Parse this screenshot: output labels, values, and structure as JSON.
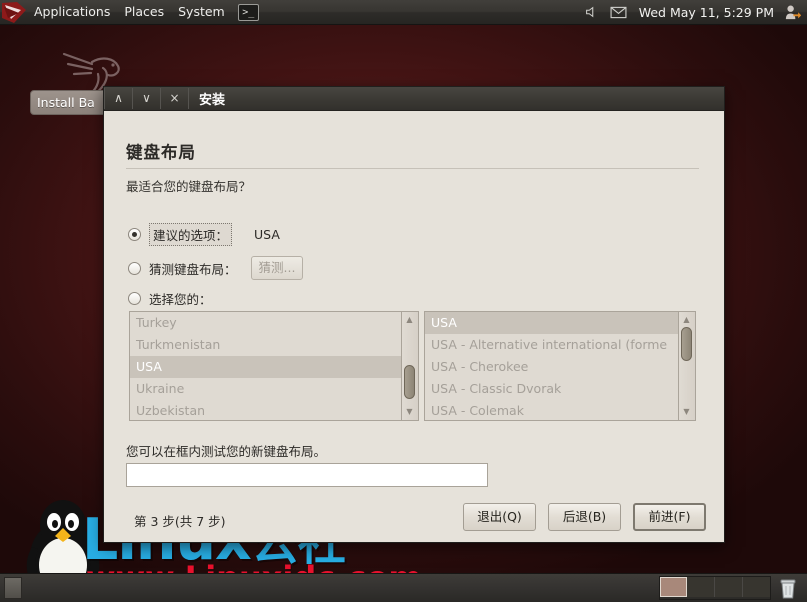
{
  "panel_top": {
    "logo_icon": "kali-dragon-logo",
    "menus": [
      "Applications",
      "Places",
      "System"
    ],
    "terminal_launcher_label": ">_",
    "tray": {
      "volume_icon": "speaker-icon",
      "mail_icon": "mail-envelope-icon",
      "clock": "Wed May 11,  5:29 PM",
      "user_icon": "user-switch-icon"
    }
  },
  "desktop": {
    "tasklist_item": "Install Ba",
    "dragon_icon": "kali-dragon-watermark",
    "tux_icon": "tux-penguin-logo",
    "watermark_main": "Linux",
    "watermark_main_cn": "公社",
    "watermark_url": "www.Linuxidc.com"
  },
  "panel_bottom": {
    "show_desktop_icon": "show-desktop-icon",
    "workspaces": [
      "1",
      "2",
      "3",
      "4"
    ],
    "active_workspace": 0,
    "trash_icon": "trash-can-icon"
  },
  "dialog": {
    "title": "安装",
    "titlebar_buttons": {
      "minimize": "∧",
      "maximize": "∨",
      "close": "×"
    },
    "heading": "键盘布局",
    "question": "最适合您的键盘布局？",
    "options": {
      "suggested": {
        "label": "建议的选项：",
        "value": "USA",
        "selected": true
      },
      "detect": {
        "label": "猜测键盘布局：",
        "button_label": "猜测...",
        "selected": false
      },
      "choose_own": {
        "label": "选择您的：",
        "selected": false
      }
    },
    "country_list": [
      "Turkey",
      "Turkmenistan",
      "USA",
      "Ukraine",
      "Uzbekistan"
    ],
    "country_selected": "USA",
    "variant_list": [
      "USA",
      "USA - Alternative international (forme",
      "USA - Cherokee",
      "USA - Classic Dvorak",
      "USA - Colemak"
    ],
    "variant_selected": "USA",
    "test_label": "您可以在框内测试您的新键盘布局。",
    "test_value": "",
    "step_info": "第 3 步(共 7 步)",
    "buttons": {
      "quit": "退出(Q)",
      "back": "后退(B)",
      "forward": "前进(F)"
    }
  },
  "colors": {
    "desktop_bg": "#3d1212",
    "panel_bg": "#373531",
    "dialog_bg": "#e6e2da",
    "watermark_blue": "#28aee4",
    "watermark_red": "#e8112d"
  }
}
